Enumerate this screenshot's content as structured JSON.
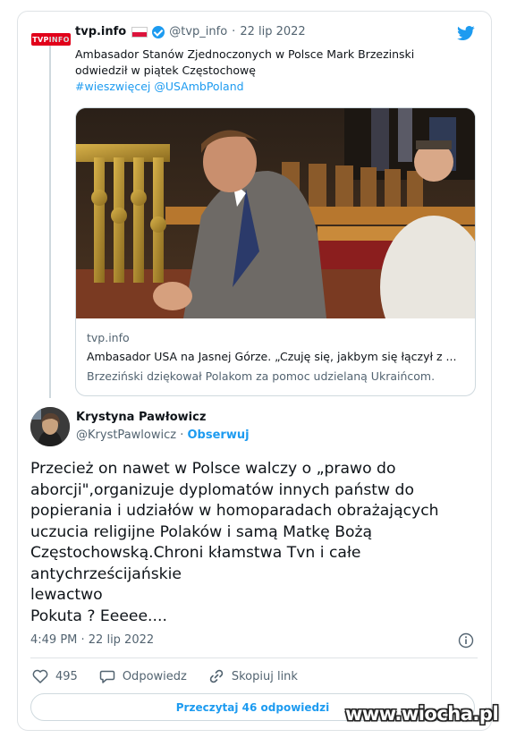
{
  "quoted": {
    "logo_text_a": "TVP",
    "logo_text_b": "INFO",
    "name": "tvp.info",
    "handle": "@tvp_info",
    "dot": "·",
    "date": "22 lip 2022",
    "text": "Ambasador Stanów Zjednoczonych w Polsce Mark Brzezinski odwiedził w piątek Częstochowę",
    "hashtag": "#wieszwięcej",
    "mention": "@USAmbPoland",
    "preview": {
      "domain": "tvp.info",
      "title": "Ambasador USA na Jasnej Górze. „Czuję się, jakbym się łączył z ...",
      "description": "Brzeziński dziękował Polakom za pomoc udzielaną Ukraińcom."
    }
  },
  "tweet": {
    "author_name": "Krystyna Pawłowicz",
    "author_handle": "@KrystPawlowicz",
    "dot": "·",
    "follow_label": "Obserwuj",
    "lines": [
      "Przecież on nawet w Polsce walczy o „prawo do",
      "aborcji\",organizuje dyplomatów innych państw do",
      "popierania i udziałów w homoparadach obrażających",
      "uczucia religijne Polaków i samą Matkę Bożą",
      "Częstochowską.Chroni kłamstwa Tvn i całe",
      "antychrześcijańskie",
      "lewactwo",
      "Pokuta ? Eeeee...."
    ],
    "timestamp": "4:49 PM · 22 lip 2022",
    "like_count": "495",
    "reply_label": "Odpowiedz",
    "copy_link_label": "Skopiuj link",
    "read_replies_label": "Przeczytaj 46 odpowiedzi"
  },
  "watermark": "www.wiocha.pl",
  "colors": {
    "link": "#1d9bf0",
    "text": "#0f1419",
    "secondary": "#536471",
    "border": "#cfd9de",
    "flag_red": "#dc143c",
    "tvp_red": "#e1001a"
  },
  "icons": [
    "twitter-bird-icon",
    "verified-badge-icon",
    "poland-flag-icon",
    "info-icon",
    "heart-icon",
    "reply-icon",
    "link-icon"
  ]
}
